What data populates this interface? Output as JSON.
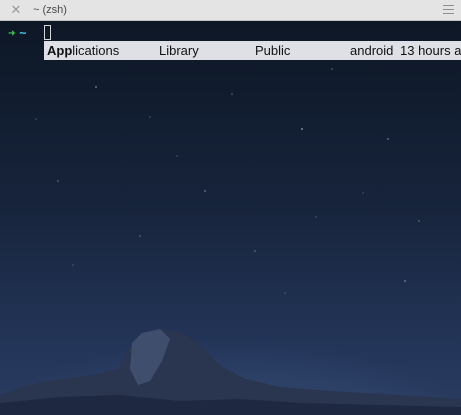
{
  "window": {
    "tab_title": "~ (zsh)",
    "close_glyph": "✕",
    "close_icon": "close-icon",
    "menu_icon": "hamburger-menu-icon"
  },
  "prompt": {
    "arrow": "➜",
    "directory": "~",
    "arrow_color": "#3ad64a",
    "directory_color": "#41c8e8"
  },
  "completion": {
    "items": [
      {
        "match": "App",
        "rest": "lications"
      },
      {
        "match": "",
        "rest": "Library"
      },
      {
        "match": "",
        "rest": "Public"
      },
      {
        "match": "",
        "rest": "android"
      }
    ],
    "trailing_text": "13 hours a"
  },
  "colors": {
    "titlebar_bg": "#e4e4e4",
    "completion_bg": "#dfe0e6",
    "background_top": "#0d1726",
    "background_bottom": "#2a3c60"
  }
}
